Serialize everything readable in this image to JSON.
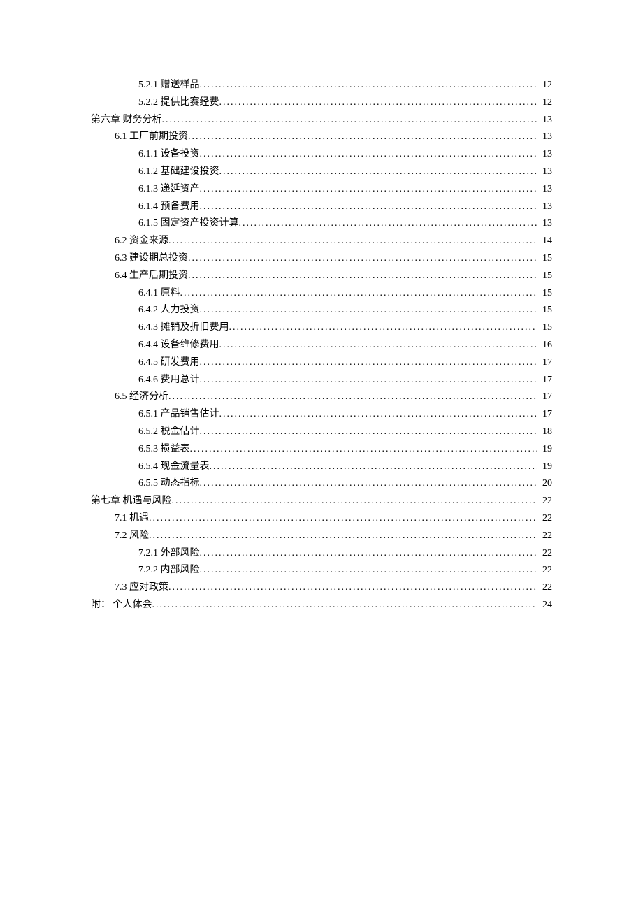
{
  "toc": [
    {
      "text": "5.2.1 赠送样品",
      "page": "12",
      "level": 2
    },
    {
      "text": "5.2.2 提供比赛经费",
      "page": "12",
      "level": 2
    },
    {
      "text": "第六章 财务分析",
      "page": "13",
      "level": 0
    },
    {
      "text": "6.1 工厂前期投资",
      "page": "13",
      "level": 1
    },
    {
      "text": "6.1.1 设备投资",
      "page": "13",
      "level": 2
    },
    {
      "text": "6.1.2 基础建设投资",
      "page": "13",
      "level": 2
    },
    {
      "text": "6.1.3 递延资产",
      "page": "13",
      "level": 2
    },
    {
      "text": "6.1.4 预备费用",
      "page": "13",
      "level": 2
    },
    {
      "text": "6.1.5 固定资产投资计算",
      "page": "13",
      "level": 2
    },
    {
      "text": "6.2 资金来源",
      "page": "14",
      "level": 1
    },
    {
      "text": "6.3 建设期总投资",
      "page": "15",
      "level": 1
    },
    {
      "text": "6.4 生产后期投资",
      "page": "15",
      "level": 1
    },
    {
      "text": "6.4.1 原料",
      "page": "15",
      "level": 2
    },
    {
      "text": "6.4.2 人力投资",
      "page": "15",
      "level": 2
    },
    {
      "text": "6.4.3 摊销及折旧费用",
      "page": "15",
      "level": 2
    },
    {
      "text": "6.4.4 设备维修费用",
      "page": "16",
      "level": 2
    },
    {
      "text": "6.4.5 研发费用",
      "page": "17",
      "level": 2
    },
    {
      "text": "6.4.6 费用总计",
      "page": "17",
      "level": 2
    },
    {
      "text": "6.5 经济分析",
      "page": "17",
      "level": 1
    },
    {
      "text": "6.5.1 产品销售估计",
      "page": "17",
      "level": 2
    },
    {
      "text": "6.5.2 税金估计",
      "page": "18",
      "level": 2
    },
    {
      "text": "6.5.3 损益表",
      "page": "19",
      "level": 2
    },
    {
      "text": "6.5.4 现金流量表",
      "page": "19",
      "level": 2
    },
    {
      "text": "6.5.5 动态指标",
      "page": "20",
      "level": 2
    },
    {
      "text": "第七章 机遇与风险",
      "page": "22",
      "level": 0
    },
    {
      "text": "7.1 机遇",
      "page": "22",
      "level": 1
    },
    {
      "text": "7.2 风险",
      "page": "22",
      "level": 1
    },
    {
      "text": "7.2.1 外部风险",
      "page": "22",
      "level": 2
    },
    {
      "text": "7.2.2 内部风险",
      "page": "22",
      "level": 2
    },
    {
      "text": "7.3 应对政策",
      "page": "22",
      "level": 1
    },
    {
      "text": "附： 个人体会",
      "page": "24",
      "level": 0
    }
  ]
}
